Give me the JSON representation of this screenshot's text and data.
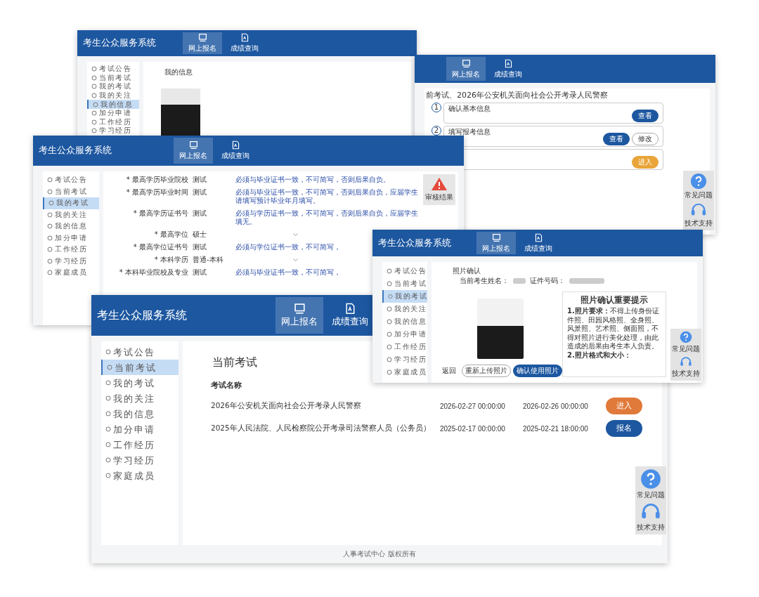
{
  "windows": [
    {
      "kind": "my_info",
      "title": "考生公众服务系统",
      "nav": [
        {
          "kind": "apply",
          "label": "网上报名",
          "selected": true
        },
        {
          "kind": "scores",
          "label": "成绩查询",
          "selected": false
        }
      ],
      "sidebar": [
        {
          "label": "考试公告",
          "selected": false
        },
        {
          "label": "当前考试",
          "selected": false
        },
        {
          "label": "我的考试",
          "selected": false
        },
        {
          "label": "我的关注",
          "selected": false
        },
        {
          "label": "我的信息",
          "selected": true
        },
        {
          "label": "加分申请",
          "selected": false
        },
        {
          "label": "工作经历",
          "selected": false
        },
        {
          "label": "学习经历",
          "selected": false
        }
      ],
      "heading": "我的信息"
    },
    {
      "kind": "exam_steps",
      "nav": [
        {
          "kind": "apply",
          "label": "网上报名",
          "selected": true
        },
        {
          "kind": "scores",
          "label": "成绩查询",
          "selected": false
        }
      ],
      "heading": "前考试、2026年公安机关面向社会公开考录人民警察",
      "steps": [
        {
          "number": "1",
          "title": "确认基本信息",
          "buttons": [
            {
              "kind": "primary",
              "label": "查看"
            }
          ]
        },
        {
          "number": "2",
          "title": "填写报考信息",
          "buttons": [
            {
              "kind": "primary",
              "label": "查看"
            },
            {
              "kind": "outline",
              "label": "修改"
            }
          ]
        },
        {
          "buttons": [
            {
              "kind": "warning",
              "label": "进入"
            }
          ]
        }
      ],
      "help": [
        {
          "kind": "faq",
          "label": "常见问题"
        },
        {
          "kind": "support",
          "label": "技术支持"
        }
      ]
    },
    {
      "kind": "form",
      "title": "考生公众服务系统",
      "nav": [
        {
          "kind": "apply",
          "label": "网上报名",
          "selected": true
        },
        {
          "kind": "scores",
          "label": "成绩查询",
          "selected": false
        }
      ],
      "sidebar": [
        {
          "label": "考试公告",
          "selected": false
        },
        {
          "label": "当前考试",
          "selected": false
        },
        {
          "label": "我的考试",
          "selected": true
        },
        {
          "label": "我的关注",
          "selected": false
        },
        {
          "label": "我的信息",
          "selected": false
        },
        {
          "label": "加分申请",
          "selected": false
        },
        {
          "label": "工作经历",
          "selected": false
        },
        {
          "label": "学习经历",
          "selected": false
        },
        {
          "label": "家庭成员",
          "selected": false
        }
      ],
      "rows": [
        {
          "kind": "text",
          "label": "* 最高学历毕业院校",
          "value": "测试",
          "hint": "必须与毕业证书一致，不可简写，否则后果自负。"
        },
        {
          "kind": "text",
          "label": "* 最高学历毕业时间",
          "value": "测试",
          "hint": "必须与毕业证书一致，不可简写，否则后果自负，应届学生请填写预计毕业年月填写。"
        },
        {
          "kind": "text",
          "label": "* 最高学历证书号",
          "value": "测试",
          "hint": "必须与学历证书一致，不可简写，否则后果自负，应届学生填无。"
        },
        {
          "kind": "select",
          "label": "* 最高学位",
          "value": "硕士"
        },
        {
          "kind": "text",
          "label": "* 最高学位证书号",
          "value": "测试",
          "hint": "必须与学位证书一致，不可简写，"
        },
        {
          "kind": "select",
          "label": "* 本科学历",
          "value": "普通-本科"
        },
        {
          "kind": "text",
          "label": "* 本科毕业院校及专业",
          "value": "测试",
          "hint": "必须与毕业证书一致，不可简写，"
        }
      ],
      "badge": "审核结果"
    },
    {
      "kind": "photo_confirm",
      "title": "考生公众服务系统",
      "nav": [
        {
          "kind": "apply",
          "label": "网上报名",
          "selected": true
        },
        {
          "kind": "scores",
          "label": "成绩查询",
          "selected": false
        }
      ],
      "sidebar": [
        {
          "label": "考试公告",
          "selected": false
        },
        {
          "label": "当前考试",
          "selected": false
        },
        {
          "label": "我的考试",
          "selected": true
        },
        {
          "label": "我的关注",
          "selected": false
        },
        {
          "label": "我的信息",
          "selected": false
        },
        {
          "label": "加分申请",
          "selected": false
        },
        {
          "label": "工作经历",
          "selected": false
        },
        {
          "label": "学习经历",
          "selected": false
        },
        {
          "label": "家庭成员",
          "selected": false
        }
      ],
      "heading": "照片确认",
      "name_label": "当前考生姓名：",
      "id_label": "证件号码：",
      "buttons": [
        {
          "kind": "text",
          "label": "返回"
        },
        {
          "kind": "outline",
          "label": "重新上传照片"
        },
        {
          "kind": "primary",
          "label": "确认使用照片"
        }
      ],
      "notice_title": "照片确认重要提示",
      "notice": [
        "**1.照片要求：**不得上传身份证件照、田园风格照、全身照、风景照、艺术照、侧面照，不得对照片进行美化处理，由此造成的后果由考生本人负责。",
        "**2.照片格式和大小：**"
      ],
      "help": [
        {
          "kind": "faq",
          "label": "常见问题"
        },
        {
          "kind": "support",
          "label": "技术支持"
        }
      ]
    },
    {
      "kind": "exam_list",
      "title": "考生公众服务系统",
      "nav": [
        {
          "kind": "apply",
          "label": "网上报名",
          "selected": true
        },
        {
          "kind": "scores",
          "label": "成绩查询",
          "selected": false
        }
      ],
      "sidebar": [
        {
          "label": "考试公告",
          "selected": false
        },
        {
          "label": "当前考试",
          "selected": true
        },
        {
          "label": "我的考试",
          "selected": false
        },
        {
          "label": "我的关注",
          "selected": false
        },
        {
          "label": "我的信息",
          "selected": false
        },
        {
          "label": "加分申请",
          "selected": false
        },
        {
          "label": "工作经历",
          "selected": false
        },
        {
          "label": "学习经历",
          "selected": false
        },
        {
          "label": "家庭成员",
          "selected": false
        }
      ],
      "heading": "当前考试",
      "column": "考试名称",
      "exams": [
        {
          "name": "2026年公安机关面向社会公开考录人民警察",
          "start": "2026-02-27 00:00:00",
          "end": "2026-02-26 00:00:00",
          "button": {
            "kind": "warning",
            "label": "进入"
          }
        },
        {
          "name": "2025年人民法院、人民检察院公开考录司法警察人员（公务员）",
          "start": "2025-02-17 00:00:00",
          "end": "2025-02-21 18:00:00",
          "button": {
            "kind": "primary",
            "label": "报名"
          }
        }
      ],
      "footer": "人事考试中心 版权所有",
      "help": [
        {
          "kind": "faq",
          "label": "常见问题"
        },
        {
          "kind": "support",
          "label": "技术支持"
        }
      ]
    }
  ]
}
